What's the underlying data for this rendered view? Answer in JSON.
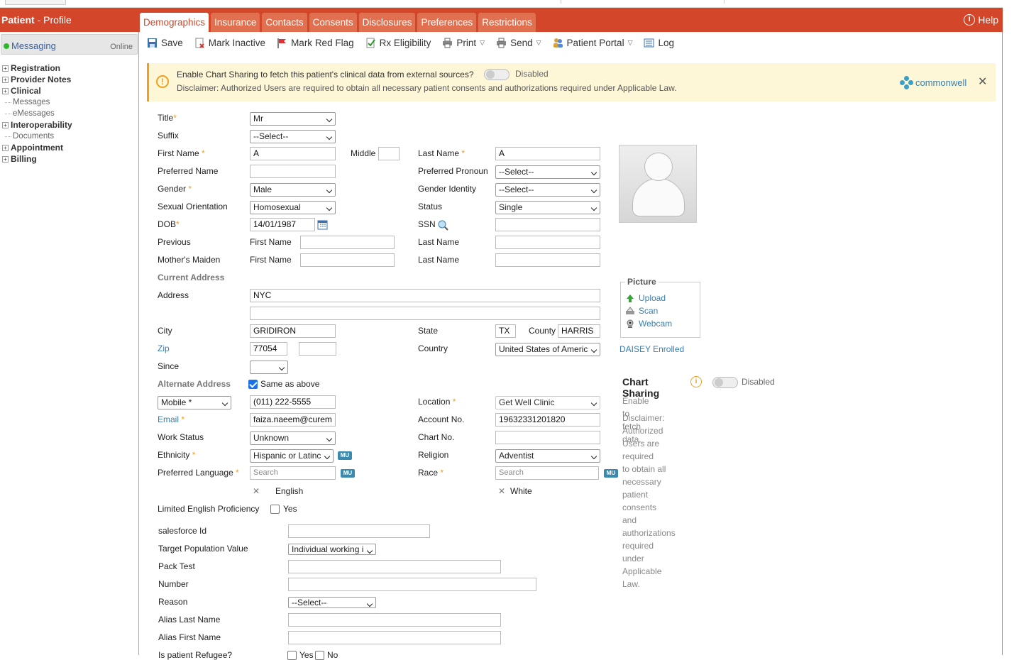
{
  "header": {
    "brand_bold": "Patient",
    "brand_sub": " - Profile",
    "help": "Help"
  },
  "tabs": [
    "Demographics",
    "Insurance",
    "Contacts",
    "Consents",
    "Disclosures",
    "Preferences",
    "Restrictions"
  ],
  "messaging": {
    "label": "Messaging",
    "status": "Online"
  },
  "tree": {
    "registration": "Registration",
    "provider_notes": "Provider Notes",
    "clinical": "Clinical",
    "messages": "Messages",
    "emessages": "eMessages",
    "interoperability": "Interoperability",
    "documents": "Documents",
    "appointment": "Appointment",
    "billing": "Billing"
  },
  "toolbar": {
    "save": "Save",
    "mark_inactive": "Mark Inactive",
    "mark_red_flag": "Mark Red Flag",
    "rx_eligibility": "Rx Eligibility",
    "print": "Print",
    "send": "Send",
    "patient_portal": "Patient Portal",
    "log": "Log"
  },
  "banner": {
    "text": "Enable Chart Sharing to fetch this patient's clinical data from external sources?",
    "toggle_state": "Disabled",
    "disclaimer": "Disclaimer: Authorized Users are required to obtain all necessary patient consents and authorizations required under Applicable Law.",
    "brand": "commonwell"
  },
  "labels": {
    "title": "Title",
    "suffix": "Suffix",
    "first_name": "First Name",
    "middle": "Middle",
    "last_name": "Last Name",
    "preferred_name": "Preferred Name",
    "preferred_pronoun": "Preferred Pronoun",
    "gender": "Gender",
    "gender_identity": "Gender Identity",
    "sexual_orientation": "Sexual Orientation",
    "status": "Status",
    "dob": "DOB",
    "ssn": "SSN",
    "previous": "Previous",
    "mothers_maiden": "Mother's Maiden",
    "sub_first_name": "First Name",
    "sub_last_name": "Last Name",
    "current_address": "Current Address",
    "address": "Address",
    "city": "City",
    "state": "State",
    "county": "County",
    "zip": "Zip",
    "country": "Country",
    "since": "Since",
    "alternate_address": "Alternate Address",
    "same_as_above": "Same as above",
    "location": "Location",
    "email": "Email",
    "account_no": "Account No.",
    "work_status": "Work Status",
    "chart_no": "Chart No.",
    "ethnicity": "Ethnicity",
    "religion": "Religion",
    "preferred_language": "Preferred Language",
    "race": "Race",
    "limited_english": "Limited English Proficiency",
    "yes": "Yes",
    "salesforce_id": "salesforce Id",
    "target_population": "Target Population Value",
    "pack_test": "Pack Test",
    "number": "Number",
    "reason": "Reason",
    "alias_last_name": "Alias Last Name",
    "alias_first_name": "Alias First Name",
    "is_refugee": "Is patient Refugee?",
    "no": "No",
    "mu": "MU",
    "asterisk": "*"
  },
  "values": {
    "title": "Mr",
    "suffix": "--Select--",
    "first_name": "A",
    "middle": "",
    "last_name": "A",
    "preferred_name": "",
    "preferred_pronoun": "--Select--",
    "gender": "Male",
    "gender_identity": "--Select--",
    "sexual_orientation": "Homosexual",
    "status": "Single",
    "dob": "14/01/1987",
    "ssn": "",
    "address1": "NYC",
    "address2": "",
    "city": "GRIDIRON",
    "state": "TX",
    "county": "HARRIS",
    "zip": "77054",
    "zip_ext": "",
    "country": "United States of Americ",
    "since": "",
    "phone_type": "Mobile *",
    "phone": "(011) 222-5555",
    "location": "Get Well Clinic",
    "email": "faiza.naeem@curem",
    "account_no": "19632331201820",
    "work_status": "Unknown",
    "chart_no": "",
    "ethnicity": "Hispanic or Latinc",
    "religion": "Adventist",
    "language_search_ph": "Search",
    "race_search_ph": "Search",
    "language_selected": "English",
    "race_selected": "White",
    "salesforce_id": "",
    "target_population": "Individual working i",
    "pack_test": "",
    "number": "",
    "reason": "--Select--",
    "alias_last_name": "",
    "alias_first_name": ""
  },
  "picture": {
    "legend": "Picture",
    "upload": "Upload",
    "scan": "Scan",
    "webcam": "Webcam",
    "daisey": "DAISEY Enrolled"
  },
  "chart_sharing": {
    "title": "Chart Sharing",
    "toggle_state": "Disabled",
    "subtitle": "Enable to fetch data.",
    "disclaimer_lines": [
      "Disclaimer: Authorized Users are required",
      "to obtain all necessary patient consents",
      "and authorizations required under",
      "Applicable Law."
    ]
  },
  "colors": {
    "brand": "#d4462a",
    "link": "#3a7fb0",
    "required": "#f0a020",
    "banner_bg": "#fdf7d8"
  }
}
